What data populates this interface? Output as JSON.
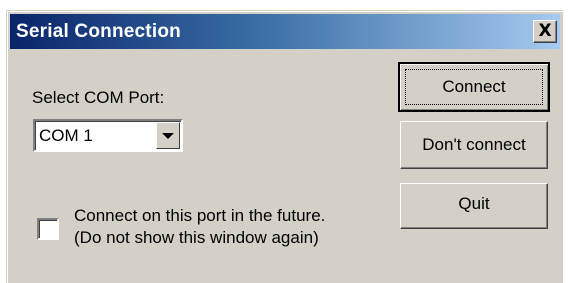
{
  "window": {
    "title": "Serial Connection",
    "close_label": "X"
  },
  "port": {
    "label": "Select COM Port:",
    "selected": "COM 1"
  },
  "remember": {
    "checked": false,
    "line1": "Connect on this port in the future.",
    "line2": "(Do not show this window again)"
  },
  "buttons": {
    "connect": "Connect",
    "dont_connect": "Don't connect",
    "quit": "Quit"
  },
  "colors": {
    "title_start": "#0a246a",
    "title_end": "#a6caf0",
    "face": "#d4d0c8"
  }
}
